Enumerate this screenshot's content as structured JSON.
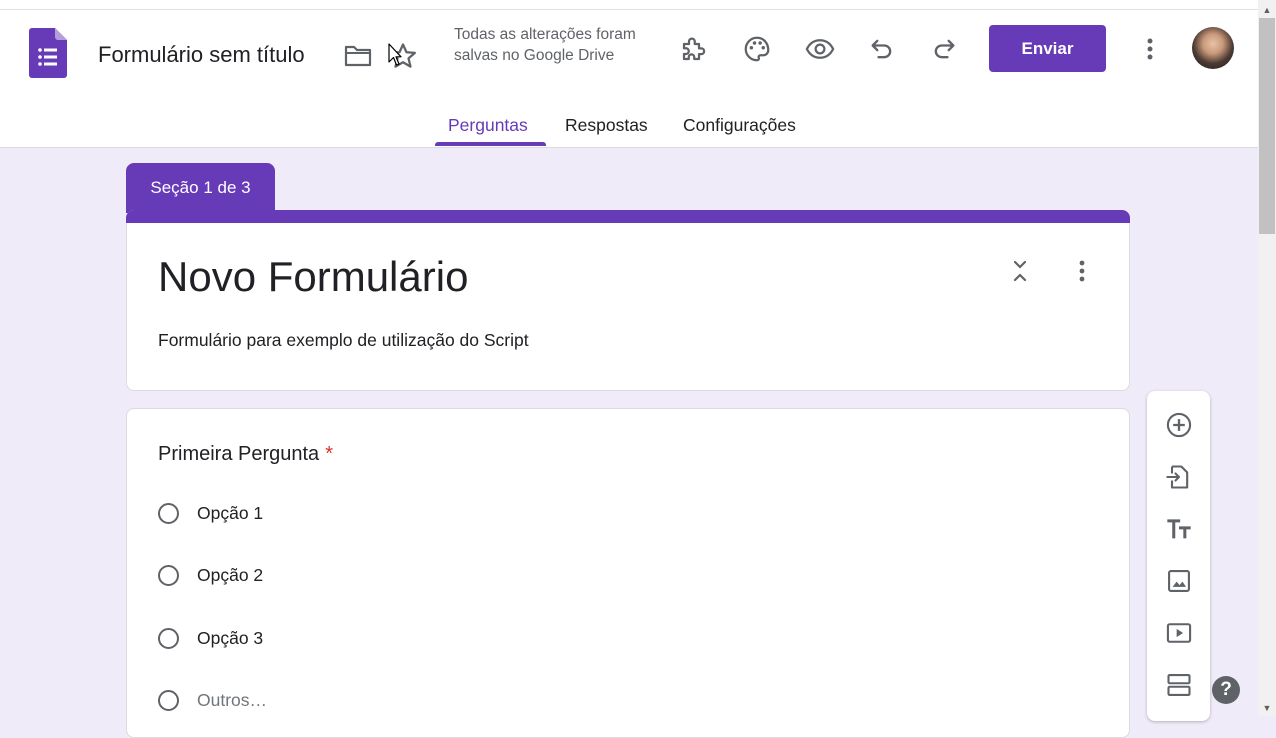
{
  "header": {
    "doc_title": "Formulário sem título",
    "save_status": "Todas as alterações foram salvas no Google Drive",
    "send_label": "Enviar"
  },
  "icons": {
    "app": "google-forms-icon",
    "folder": "folder-icon",
    "star": "star-icon",
    "addons": "puzzle-icon",
    "theme": "palette-icon",
    "preview": "eye-icon",
    "undo": "undo-icon",
    "redo": "redo-icon",
    "more": "more-vert-icon"
  },
  "tabs": [
    {
      "label": "Perguntas",
      "active": true
    },
    {
      "label": "Respostas",
      "active": false
    },
    {
      "label": "Configurações",
      "active": false
    }
  ],
  "section": {
    "badge": "Seção 1 de 3",
    "title": "Novo Formulário",
    "description": "Formulário para exemplo de utilização do Script"
  },
  "question": {
    "title": "Primeira Pergunta",
    "required_mark": "*",
    "options": [
      {
        "label": "Opção 1"
      },
      {
        "label": "Opção 2"
      },
      {
        "label": "Opção 3"
      },
      {
        "label": "Outros…"
      }
    ]
  },
  "toolbar": {
    "items": [
      "add-question-icon",
      "import-questions-icon",
      "add-title-icon",
      "add-image-icon",
      "add-video-icon",
      "add-section-icon"
    ]
  },
  "help_label": "?",
  "colors": {
    "accent": "#673ab7",
    "background": "#f0ebf8",
    "required": "#d93025"
  }
}
